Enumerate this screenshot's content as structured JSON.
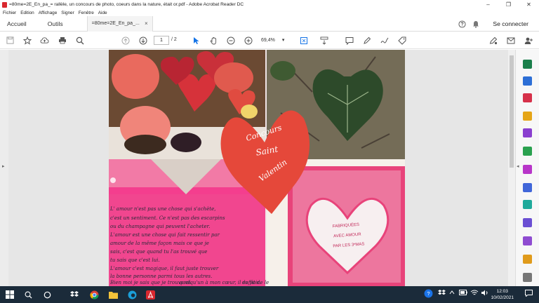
{
  "window": {
    "title": "=80me=2E_En_pa_= rallèle, un concours de photo, coeurs dans la nature, était or.pdf - Adobe Acrobat Reader DC",
    "minimize": "–",
    "maximize": "❐",
    "close": "✕"
  },
  "menu": [
    "Fichier",
    "Edition",
    "Affichage",
    "Signer",
    "Fenêtre",
    "Aide"
  ],
  "tabs": {
    "home": "Accueil",
    "tools": "Outils",
    "document": "=80me=2E_En_pa_...",
    "document_close": "×",
    "sign_in": "Se connecter"
  },
  "toolbar": {
    "page_current": "1",
    "page_total": "/ 2",
    "zoom": "69,4%",
    "zoom_arrow": "▾"
  },
  "page_content": {
    "banner_lines": [
      "Concours",
      "Saint",
      "Valentin"
    ],
    "card_lines": [
      "FABRIQUÉES",
      "AVEC AMOUR",
      "PAR LES 3ᵉMAS"
    ],
    "poem_lines": [
      "L' amour n'est pas une chose qui s'achète,",
      "c'est un sentiment. Ce n'est pas des escarpins",
      "ou du champagne qui peuvent l'acheter.",
      "L'amour est une chose qui fait ressentir par",
      "amour de la même façon mais ce que je",
      "sais, c'est que quand tu l'as trouvé que",
      "tu sais que c'est lui.",
      "L'amour c'est magique, il faut juste trouver",
      "la bonne personne parmi tous les autres.",
      "Bien moi je sais que je trouverai",
      "quelqu'un à mon cœur, il suffit de le",
      "de voir."
    ]
  },
  "taskbar": {
    "time": "12:03",
    "date": "10/02/2021"
  },
  "colors": {
    "taskbar": "#1b2b3a",
    "heart": "#e5483a",
    "pink_paper": "#f43e8e",
    "card_pink": "#e8437a",
    "acrobat_red": "#d9282f"
  }
}
